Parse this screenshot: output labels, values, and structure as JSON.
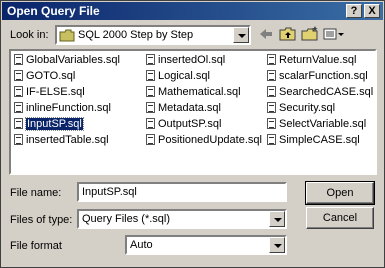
{
  "window": {
    "title": "Open Query File",
    "help_button": "?",
    "close_button": "X"
  },
  "look_in": {
    "label": "Look in:",
    "value": "SQL 2000 Step by Step"
  },
  "files": [
    {
      "name": "GlobalVariables.sql",
      "selected": false
    },
    {
      "name": "GOTO.sql",
      "selected": false
    },
    {
      "name": "IF-ELSE.sql",
      "selected": false
    },
    {
      "name": "inlineFunction.sql",
      "selected": false
    },
    {
      "name": "InputSP.sql",
      "selected": true
    },
    {
      "name": "insertedTable.sql",
      "selected": false
    },
    {
      "name": "insertedOl.sql",
      "selected": false
    },
    {
      "name": "Logical.sql",
      "selected": false
    },
    {
      "name": "Mathematical.sql",
      "selected": false
    },
    {
      "name": "Metadata.sql",
      "selected": false
    },
    {
      "name": "OutputSP.sql",
      "selected": false
    },
    {
      "name": "PositionedUpdate.sql",
      "selected": false
    },
    {
      "name": "ReturnValue.sql",
      "selected": false
    },
    {
      "name": "scalarFunction.sql",
      "selected": false
    },
    {
      "name": "SearchedCASE.sql",
      "selected": false
    },
    {
      "name": "Security.sql",
      "selected": false
    },
    {
      "name": "SelectVariable.sql",
      "selected": false
    },
    {
      "name": "SimpleCASE.sql",
      "selected": false
    }
  ],
  "file_name": {
    "label": "File name:",
    "value": "InputSP.sql"
  },
  "files_of_type": {
    "label": "Files of type:",
    "value": "Query Files (*.sql)"
  },
  "file_format": {
    "label": "File format",
    "value": "Auto"
  },
  "buttons": {
    "open": "Open",
    "cancel": "Cancel"
  },
  "icons": [
    "folder-icon",
    "back-arrow-icon",
    "up-folder-icon",
    "new-folder-icon",
    "view-menu-icon",
    "sql-file-icon"
  ],
  "colors": {
    "titlebar": "#0a246a",
    "selection": "#0a246a",
    "face": "#d4d0c8"
  }
}
